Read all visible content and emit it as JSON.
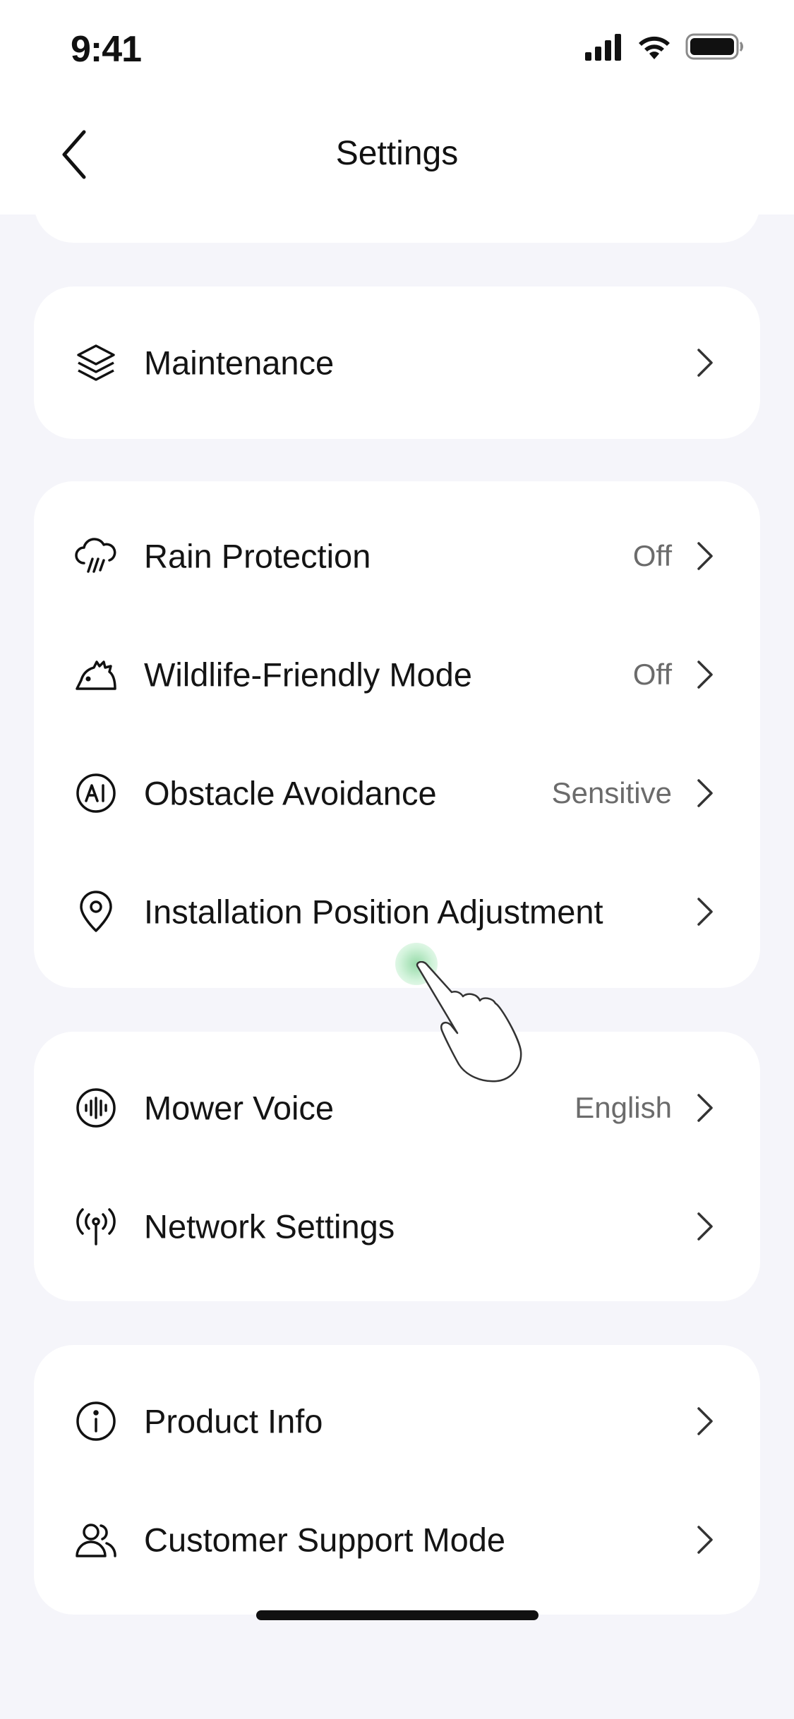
{
  "status_bar": {
    "time": "9:41"
  },
  "header": {
    "title": "Settings"
  },
  "sections": [
    {
      "items": [
        {
          "label": "Maintenance",
          "value": "",
          "icon": "layers-icon"
        }
      ]
    },
    {
      "items": [
        {
          "label": "Rain Protection",
          "value": "Off",
          "icon": "rain-cloud-icon"
        },
        {
          "label": "Wildlife-Friendly Mode",
          "value": "Off",
          "icon": "hedgehog-icon"
        },
        {
          "label": "Obstacle Avoidance",
          "value": "Sensitive",
          "icon": "ai-icon"
        },
        {
          "label": "Installation Position Adjustment",
          "value": "",
          "icon": "location-pin-icon"
        }
      ]
    },
    {
      "items": [
        {
          "label": "Mower Voice",
          "value": "English",
          "icon": "voice-wave-icon"
        },
        {
          "label": "Network Settings",
          "value": "",
          "icon": "antenna-icon"
        }
      ]
    },
    {
      "items": [
        {
          "label": "Product Info",
          "value": "",
          "icon": "info-icon"
        },
        {
          "label": "Customer Support Mode",
          "value": "",
          "icon": "users-icon"
        }
      ]
    }
  ]
}
